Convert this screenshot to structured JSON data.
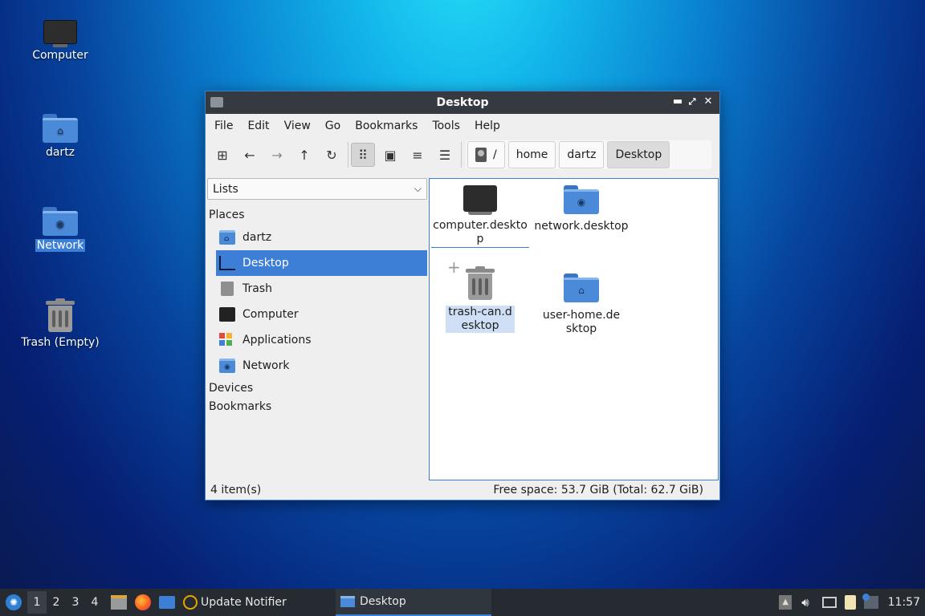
{
  "desktop": {
    "icons": [
      {
        "label": "Computer",
        "icon": "monitor-icon"
      },
      {
        "label": "dartz",
        "icon": "home-folder-icon"
      },
      {
        "label": "Network",
        "icon": "network-folder-icon"
      },
      {
        "label": "Trash (Empty)",
        "icon": "trash-icon"
      }
    ]
  },
  "window": {
    "title": "Desktop",
    "controls": {
      "minimize": "▬",
      "maximize": "⤢",
      "close": "✕"
    },
    "menu": [
      "File",
      "Edit",
      "View",
      "Go",
      "Bookmarks",
      "Tools",
      "Help"
    ],
    "toolbar": {
      "new_tab": "⊞",
      "back": "←",
      "forward": "→",
      "up": "↑",
      "reload": "↻",
      "icon_view": "⠿",
      "thumbnail_view": "▣",
      "compact_view": "≡",
      "detailed_view": "☰"
    },
    "path": {
      "root": "/",
      "segments": [
        "home",
        "dartz",
        "Desktop"
      ]
    },
    "side_pane": {
      "mode": "Lists",
      "places_header": "Places",
      "places": [
        {
          "label": "dartz",
          "icon": "home-folder-icon"
        },
        {
          "label": "Desktop",
          "icon": "desktop-icon"
        },
        {
          "label": "Trash",
          "icon": "trash-icon"
        },
        {
          "label": "Computer",
          "icon": "monitor-icon"
        },
        {
          "label": "Applications",
          "icon": "applications-icon"
        },
        {
          "label": "Network",
          "icon": "network-folder-icon"
        }
      ],
      "devices_header": "Devices",
      "bookmarks_header": "Bookmarks"
    },
    "files": [
      {
        "name": "computer.desktop",
        "icon": "monitor-icon"
      },
      {
        "name": "network.desktop",
        "icon": "network-folder-icon"
      },
      {
        "name": "trash-can.desktop",
        "icon": "trash-icon"
      },
      {
        "name": "user-home.desktop",
        "icon": "home-folder-icon"
      }
    ],
    "status": {
      "count": "4 item(s)",
      "free_space": "Free space: 53.7 GiB (Total: 62.7 GiB)"
    }
  },
  "taskbar": {
    "workspaces": [
      "1",
      "2",
      "3",
      "4"
    ],
    "tasks": [
      {
        "label": "Update Notifier",
        "icon": "update-notifier-icon"
      },
      {
        "label": "Desktop",
        "icon": "folder-icon"
      }
    ],
    "clock": "11:57"
  },
  "colors": {
    "selection": "#3d7fd6",
    "titlebar": "#353a41",
    "taskbar": "#262b31"
  }
}
